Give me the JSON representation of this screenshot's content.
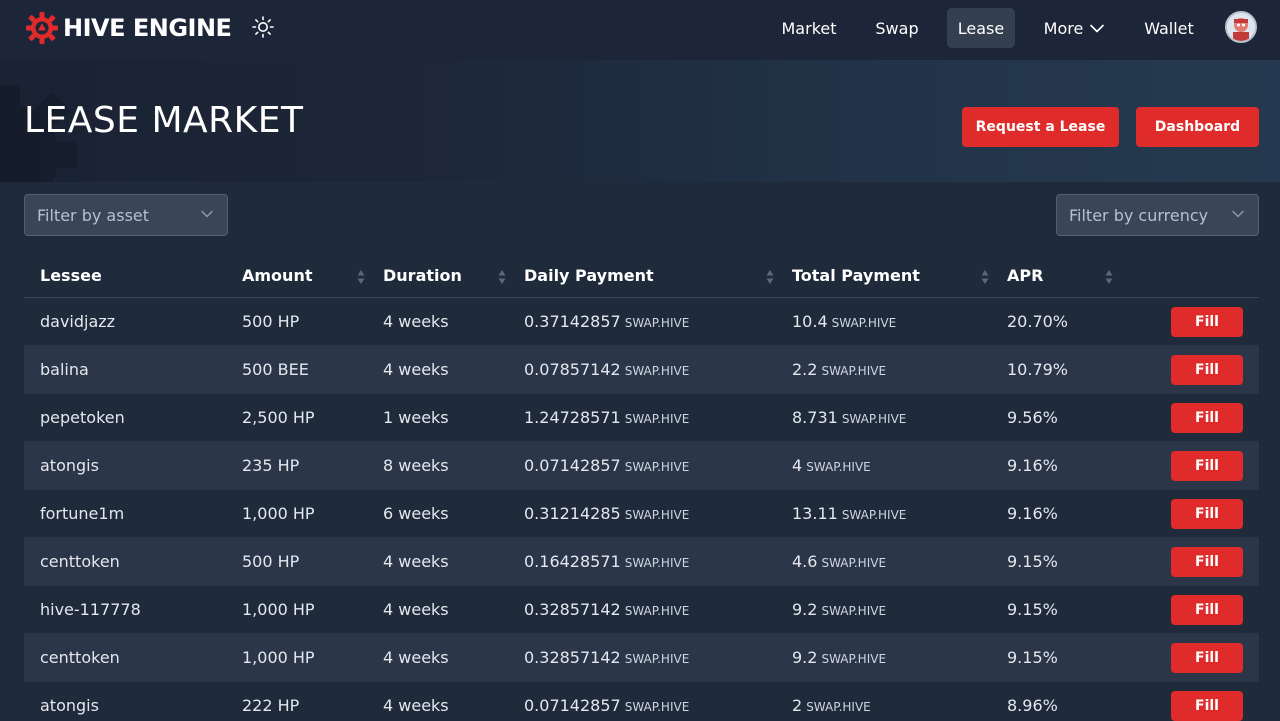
{
  "brand": {
    "name": "HIVE ENGINE"
  },
  "nav": [
    {
      "label": "Market"
    },
    {
      "label": "Swap"
    },
    {
      "label": "Lease"
    },
    {
      "label": "More"
    },
    {
      "label": "Wallet"
    }
  ],
  "hero": {
    "title": "LEASE MARKET",
    "request_label": "Request a Lease",
    "dashboard_label": "Dashboard"
  },
  "filters": {
    "asset_placeholder": "Filter by asset",
    "currency_placeholder": "Filter by currency"
  },
  "table": {
    "columns": [
      "Lessee",
      "Amount",
      "Duration",
      "Daily Payment",
      "Total Payment",
      "APR"
    ],
    "fill_label": "Fill",
    "rows": [
      {
        "lessee": "davidjazz",
        "amount": "500 HP",
        "duration": "4 weeks",
        "daily": "0.37142857",
        "daily_cur": "SWAP.HIVE",
        "total": "10.4",
        "total_cur": "SWAP.HIVE",
        "apr": "20.70%"
      },
      {
        "lessee": "balina",
        "amount": "500 BEE",
        "duration": "4 weeks",
        "daily": "0.07857142",
        "daily_cur": "SWAP.HIVE",
        "total": "2.2",
        "total_cur": "SWAP.HIVE",
        "apr": "10.79%"
      },
      {
        "lessee": "pepetoken",
        "amount": "2,500 HP",
        "duration": "1 weeks",
        "daily": "1.24728571",
        "daily_cur": "SWAP.HIVE",
        "total": "8.731",
        "total_cur": "SWAP.HIVE",
        "apr": "9.56%"
      },
      {
        "lessee": "atongis",
        "amount": "235 HP",
        "duration": "8 weeks",
        "daily": "0.07142857",
        "daily_cur": "SWAP.HIVE",
        "total": "4",
        "total_cur": "SWAP.HIVE",
        "apr": "9.16%"
      },
      {
        "lessee": "fortune1m",
        "amount": "1,000 HP",
        "duration": "6 weeks",
        "daily": "0.31214285",
        "daily_cur": "SWAP.HIVE",
        "total": "13.11",
        "total_cur": "SWAP.HIVE",
        "apr": "9.16%"
      },
      {
        "lessee": "centtoken",
        "amount": "500 HP",
        "duration": "4 weeks",
        "daily": "0.16428571",
        "daily_cur": "SWAP.HIVE",
        "total": "4.6",
        "total_cur": "SWAP.HIVE",
        "apr": "9.15%"
      },
      {
        "lessee": "hive-117778",
        "amount": "1,000 HP",
        "duration": "4 weeks",
        "daily": "0.32857142",
        "daily_cur": "SWAP.HIVE",
        "total": "9.2",
        "total_cur": "SWAP.HIVE",
        "apr": "9.15%"
      },
      {
        "lessee": "centtoken",
        "amount": "1,000 HP",
        "duration": "4 weeks",
        "daily": "0.32857142",
        "daily_cur": "SWAP.HIVE",
        "total": "9.2",
        "total_cur": "SWAP.HIVE",
        "apr": "9.15%"
      },
      {
        "lessee": "atongis",
        "amount": "222 HP",
        "duration": "4 weeks",
        "daily": "0.07142857",
        "daily_cur": "SWAP.HIVE",
        "total": "2",
        "total_cur": "SWAP.HIVE",
        "apr": "8.96%"
      }
    ]
  },
  "colors": {
    "accent": "#e02b2b",
    "background": "#1f2a3b",
    "header": "#1c2638"
  },
  "icons": {
    "logo": "hive-engine-logo-icon",
    "theme": "sun-icon",
    "more": "chevron-down-icon",
    "avatar": "user-avatar",
    "sort": "sort-icon"
  }
}
